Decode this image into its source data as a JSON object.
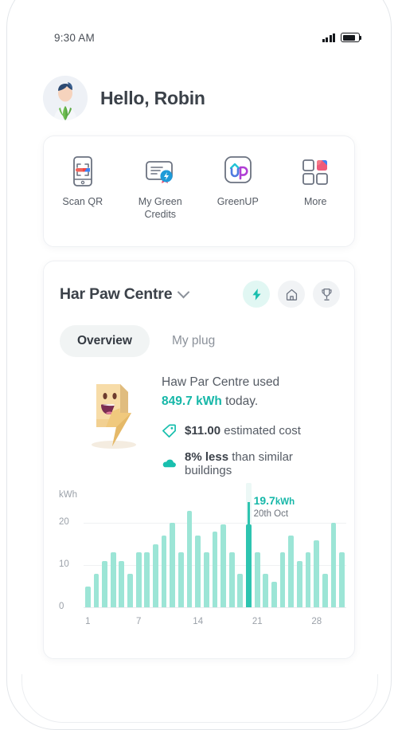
{
  "status_bar": {
    "time": "9:30 AM",
    "signal_icon": "signal-bars-icon",
    "battery_icon": "battery-icon"
  },
  "greeting": {
    "text": "Hello, Robin",
    "avatar_icon": "user-avatar-plant"
  },
  "quick_actions": [
    {
      "label": "Scan QR",
      "icon": "scan-qr-icon"
    },
    {
      "label": "My Green Credits",
      "icon": "green-credits-certificate-icon"
    },
    {
      "label": "GreenUP",
      "icon": "greenup-logo-icon"
    },
    {
      "label": "More",
      "icon": "more-grid-icon"
    }
  ],
  "usage_card": {
    "building_name": "Har Paw Centre",
    "chevron_icon": "chevron-down-icon",
    "header_actions": [
      {
        "icon": "bolt-icon",
        "active": true
      },
      {
        "icon": "home-icon",
        "active": false
      },
      {
        "icon": "trophy-icon",
        "active": false
      }
    ],
    "tabs": [
      {
        "label": "Overview",
        "selected": true
      },
      {
        "label": "My plug",
        "selected": false
      }
    ],
    "summary": {
      "mascot_icon": "lightning-bolt-mascot",
      "line_prefix": "Haw Par Centre used",
      "value": "849.7 kWh",
      "line_suffix": "today.",
      "stats": [
        {
          "icon": "price-tag-icon",
          "value": "$11.00",
          "text": "estimated cost"
        },
        {
          "icon": "cloud-icon",
          "value": "8% less",
          "text": "than similar buildings"
        }
      ]
    }
  },
  "chart_data": {
    "type": "bar",
    "title": "",
    "xlabel": "",
    "ylabel": "kWh",
    "unit_label": "kWh",
    "ylim": [
      0,
      25
    ],
    "yticks": [
      0,
      10,
      20
    ],
    "ytick_labels": [
      "0",
      "10",
      "20"
    ],
    "xticks": [
      1,
      7,
      14,
      21,
      28
    ],
    "xtick_labels": [
      "1",
      "7",
      "14",
      "21",
      "28"
    ],
    "grid": true,
    "legend": "none",
    "categories": [
      1,
      2,
      3,
      4,
      5,
      6,
      7,
      8,
      9,
      10,
      11,
      12,
      13,
      14,
      15,
      16,
      17,
      18,
      19,
      20,
      21,
      22,
      23,
      24,
      25,
      26,
      27,
      28,
      29,
      30,
      31
    ],
    "values": [
      5,
      8,
      11,
      13,
      11,
      8,
      13,
      13,
      15,
      17,
      20,
      13,
      23,
      17,
      13,
      18,
      19.7,
      13,
      8,
      19.7,
      13,
      8,
      6,
      13,
      17,
      11,
      13,
      16,
      8,
      20,
      13
    ],
    "bar_color": "#9ce5d6",
    "highlight_color": "#2ec4b0",
    "highlight_index": 19,
    "highlight": {
      "value": "19.7",
      "unit": "kWh",
      "date": "20th Oct"
    }
  }
}
